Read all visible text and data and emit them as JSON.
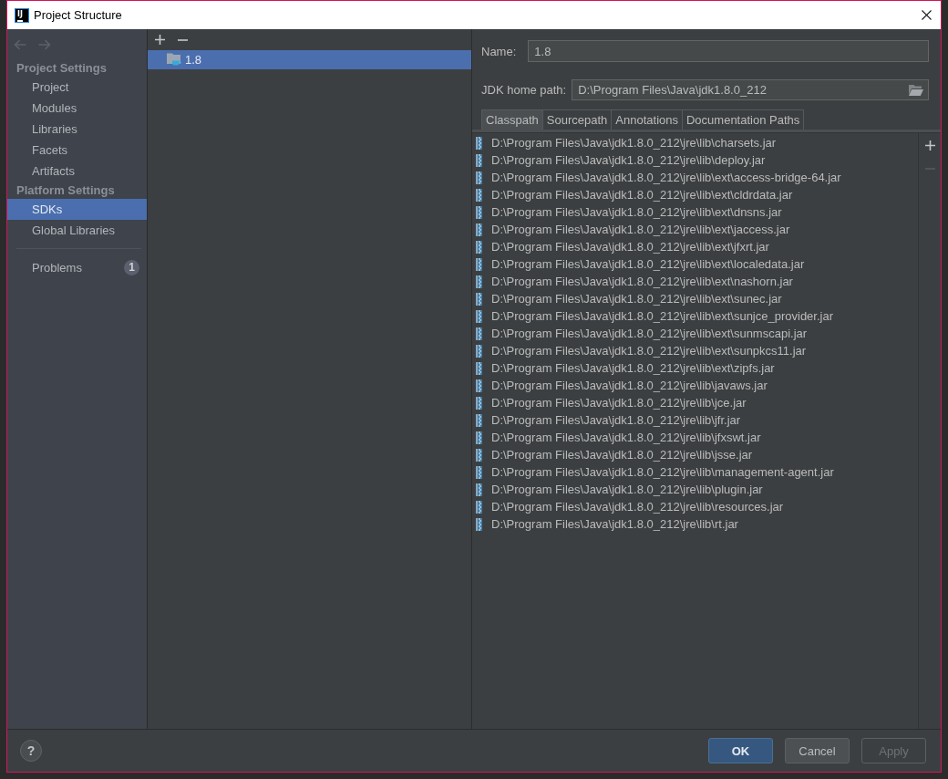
{
  "window": {
    "title": "Project Structure",
    "icon_text": "IJ"
  },
  "sidebar": {
    "navigation": [
      {
        "kind": "back",
        "disabled": true
      },
      {
        "kind": "forward",
        "disabled": true
      }
    ],
    "sections": [
      {
        "title": "Project Settings",
        "items": [
          {
            "label": "Project",
            "selected": false
          },
          {
            "label": "Modules",
            "selected": false
          },
          {
            "label": "Libraries",
            "selected": false
          },
          {
            "label": "Facets",
            "selected": false
          },
          {
            "label": "Artifacts",
            "selected": false
          }
        ]
      },
      {
        "title": "Platform Settings",
        "items": [
          {
            "label": "SDKs",
            "selected": true
          },
          {
            "label": "Global Libraries",
            "selected": false
          }
        ]
      }
    ],
    "problems": {
      "label": "Problems",
      "count": "1",
      "selected": false
    }
  },
  "sdk_list": {
    "toolbar": [
      {
        "kind": "add",
        "disabled": false
      },
      {
        "kind": "remove",
        "disabled": false
      }
    ],
    "items": [
      {
        "label": "1.8",
        "selected": true
      }
    ]
  },
  "sdk_details": {
    "name": {
      "label": "Name:",
      "value": "1.8"
    },
    "home_path": {
      "label": "JDK home path:",
      "value": "D:\\Program Files\\Java\\jdk1.8.0_212"
    },
    "tabs": [
      {
        "label": "Classpath",
        "selected": true
      },
      {
        "label": "Sourcepath",
        "selected": false
      },
      {
        "label": "Annotations",
        "selected": false
      },
      {
        "label": "Documentation Paths",
        "selected": false
      }
    ],
    "classpath": [
      "D:\\Program Files\\Java\\jdk1.8.0_212\\jre\\lib\\charsets.jar",
      "D:\\Program Files\\Java\\jdk1.8.0_212\\jre\\lib\\deploy.jar",
      "D:\\Program Files\\Java\\jdk1.8.0_212\\jre\\lib\\ext\\access-bridge-64.jar",
      "D:\\Program Files\\Java\\jdk1.8.0_212\\jre\\lib\\ext\\cldrdata.jar",
      "D:\\Program Files\\Java\\jdk1.8.0_212\\jre\\lib\\ext\\dnsns.jar",
      "D:\\Program Files\\Java\\jdk1.8.0_212\\jre\\lib\\ext\\jaccess.jar",
      "D:\\Program Files\\Java\\jdk1.8.0_212\\jre\\lib\\ext\\jfxrt.jar",
      "D:\\Program Files\\Java\\jdk1.8.0_212\\jre\\lib\\ext\\localedata.jar",
      "D:\\Program Files\\Java\\jdk1.8.0_212\\jre\\lib\\ext\\nashorn.jar",
      "D:\\Program Files\\Java\\jdk1.8.0_212\\jre\\lib\\ext\\sunec.jar",
      "D:\\Program Files\\Java\\jdk1.8.0_212\\jre\\lib\\ext\\sunjce_provider.jar",
      "D:\\Program Files\\Java\\jdk1.8.0_212\\jre\\lib\\ext\\sunmscapi.jar",
      "D:\\Program Files\\Java\\jdk1.8.0_212\\jre\\lib\\ext\\sunpkcs11.jar",
      "D:\\Program Files\\Java\\jdk1.8.0_212\\jre\\lib\\ext\\zipfs.jar",
      "D:\\Program Files\\Java\\jdk1.8.0_212\\jre\\lib\\javaws.jar",
      "D:\\Program Files\\Java\\jdk1.8.0_212\\jre\\lib\\jce.jar",
      "D:\\Program Files\\Java\\jdk1.8.0_212\\jre\\lib\\jfr.jar",
      "D:\\Program Files\\Java\\jdk1.8.0_212\\jre\\lib\\jfxswt.jar",
      "D:\\Program Files\\Java\\jdk1.8.0_212\\jre\\lib\\jsse.jar",
      "D:\\Program Files\\Java\\jdk1.8.0_212\\jre\\lib\\management-agent.jar",
      "D:\\Program Files\\Java\\jdk1.8.0_212\\jre\\lib\\plugin.jar",
      "D:\\Program Files\\Java\\jdk1.8.0_212\\jre\\lib\\resources.jar",
      "D:\\Program Files\\Java\\jdk1.8.0_212\\jre\\lib\\rt.jar"
    ],
    "side_toolbar": [
      {
        "kind": "add",
        "disabled": false
      },
      {
        "kind": "remove",
        "disabled": true
      }
    ]
  },
  "footer": {
    "help": "?",
    "buttons": [
      {
        "label": "OK",
        "default": true,
        "disabled": false
      },
      {
        "label": "Cancel",
        "default": false,
        "disabled": false
      },
      {
        "label": "Apply",
        "default": false,
        "disabled": true
      }
    ]
  }
}
